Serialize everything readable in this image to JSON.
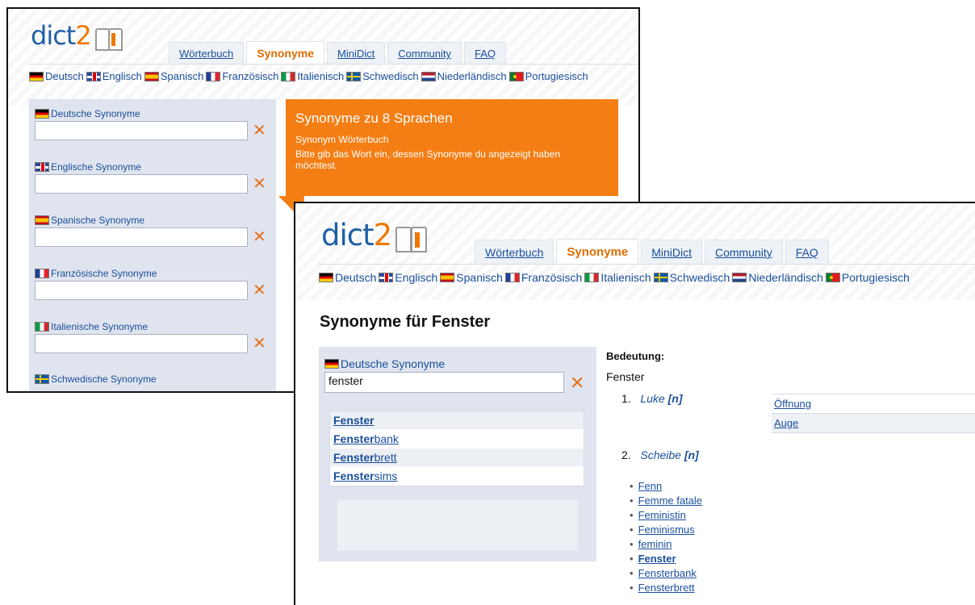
{
  "window1": {
    "logo": {
      "text": "dict",
      "accent": "2"
    },
    "tabs": [
      {
        "label": "Wörterbuch",
        "active": false
      },
      {
        "label": "Synonyme",
        "active": true
      },
      {
        "label": "MiniDict",
        "active": false
      },
      {
        "label": "Community",
        "active": false
      },
      {
        "label": "FAQ",
        "active": false
      }
    ],
    "languages": [
      "Deutsch",
      "Englisch",
      "Spanisch",
      "Französisch",
      "Italienisch",
      "Schwedisch",
      "Niederländisch",
      "Portugiesisch"
    ],
    "fields": [
      {
        "label": "Deutsche Synonyme",
        "value": ""
      },
      {
        "label": "Englische Synonyme",
        "value": ""
      },
      {
        "label": "Spanische Synonyme",
        "value": ""
      },
      {
        "label": "Französische Synonyme",
        "value": ""
      },
      {
        "label": "Italienische Synonyme",
        "value": ""
      },
      {
        "label": "Schwedische Synonyme",
        "value": ""
      }
    ],
    "callout": {
      "title": "Synonyme zu 8 Sprachen",
      "subtitle": "Synonym Wörterbuch",
      "text": "Bitte gib das Wort ein, dessen Synonyme du angezeigt haben möchtest."
    }
  },
  "window2": {
    "logo": {
      "text": "dict",
      "accent": "2"
    },
    "tabs": [
      {
        "label": "Wörterbuch",
        "active": false
      },
      {
        "label": "Synonyme",
        "active": true
      },
      {
        "label": "MiniDict",
        "active": false
      },
      {
        "label": "Community",
        "active": false
      },
      {
        "label": "FAQ",
        "active": false
      }
    ],
    "languages": [
      "Deutsch",
      "Englisch",
      "Spanisch",
      "Französisch",
      "Italienisch",
      "Schwedisch",
      "Niederländisch",
      "Portugiesisch"
    ],
    "page_title": "Synonyme für Fenster",
    "search": {
      "label": "Deutsche Synonyme",
      "value": "fenster"
    },
    "suggestions": [
      {
        "match": "Fenster",
        "rest": ""
      },
      {
        "match": "Fenster",
        "rest": "bank"
      },
      {
        "match": "Fenster",
        "rest": "brett"
      },
      {
        "match": "Fenster",
        "rest": "sims"
      }
    ],
    "meaning_heading": "Bedeutung:",
    "meaning_word": "Fenster",
    "senses": [
      {
        "num": "1.",
        "word": "Luke",
        "pos": "[n]"
      },
      {
        "num": "2.",
        "word": "Scheibe",
        "pos": "[n]"
      }
    ],
    "related": [
      "Öffnung",
      "Auge"
    ],
    "word_list": [
      "Fenn",
      "Femme fatale",
      "Feministin",
      "Feminismus",
      "feminin",
      "Fenster",
      "Fensterbank",
      "Fensterbrett"
    ]
  },
  "colors": {
    "accent": "#f07800",
    "link": "#1a4f9c",
    "panel": "#dfe4ee"
  }
}
